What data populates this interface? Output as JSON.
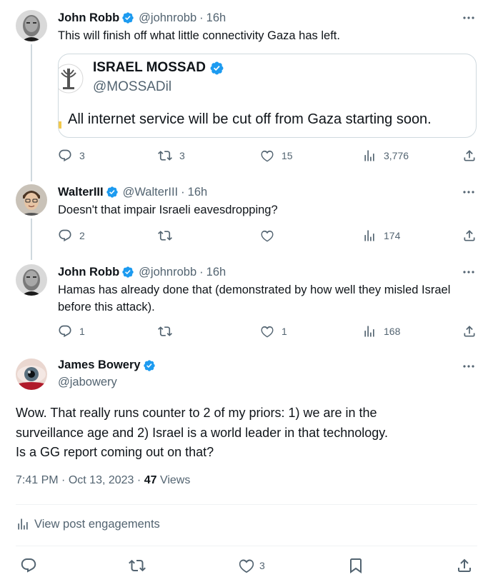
{
  "thread": [
    {
      "author": "John Robb",
      "handle": "@johnrobb",
      "age": "16h",
      "text": "This will finish off what little connectivity Gaza has left.",
      "quote": {
        "author": "ISRAEL MOSSAD",
        "handle": "@MOSSADil",
        "text": "All internet service will be cut off from Gaza starting soon."
      },
      "replies": "3",
      "reposts": "3",
      "likes": "15",
      "views": "3,776"
    },
    {
      "author": "WalterIII",
      "handle": "@WalterIII",
      "age": "16h",
      "text": "Doesn't that impair Israeli eavesdropping?",
      "replies": "2",
      "reposts": "",
      "likes": "",
      "views": "174"
    },
    {
      "author": "John Robb",
      "handle": "@johnrobb",
      "age": "16h",
      "text_line1": "Hamas has already done that (demonstrated by how well they misled Israel",
      "text_line2": "before this attack).",
      "replies": "1",
      "reposts": "",
      "likes": "1",
      "views": "168"
    }
  ],
  "main": {
    "author": "James Bowery",
    "handle": "@jabowery",
    "line1": "Wow.  That really runs counter to 2 of my priors: 1) we are in the",
    "line2": "surveillance age and 2) Israel is a world leader in that technology.",
    "line3": "Is a GG report coming out on that?",
    "time": "7:41 PM",
    "date": "Oct 13, 2023",
    "views_count": "47",
    "views_label": "Views",
    "engagements_label": "View post engagements",
    "likes": "3"
  },
  "separator": "·",
  "colors": {
    "verified": "#1d9bf0",
    "secondary_text": "#536471",
    "primary_text": "#0f1419",
    "border": "#cfd9de"
  }
}
